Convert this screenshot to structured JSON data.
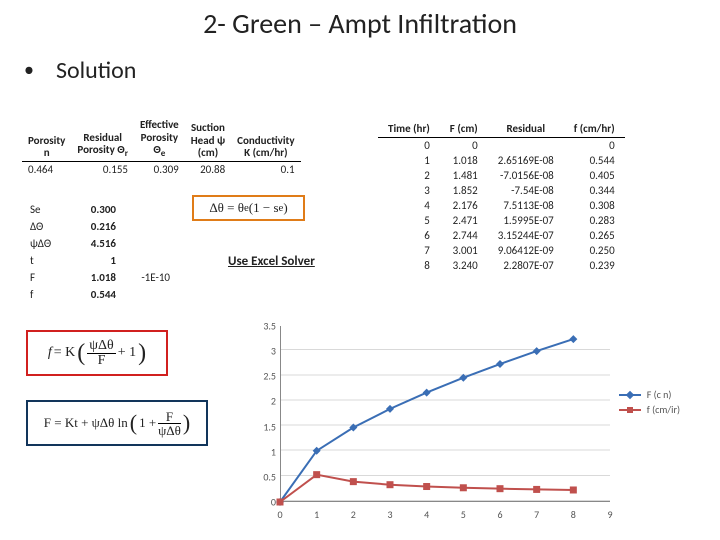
{
  "title": "2- Green – Ampt Infiltration",
  "bullet": "Solution",
  "params": {
    "headers": [
      "Porosity n",
      "Residual Porosity Θr",
      "Effective Porosity Θe",
      "Suction Head ψ (cm)",
      "Conductivity K (cm/hr)"
    ],
    "row": [
      "0.464",
      "0.155",
      "0.309",
      "20.88",
      "0.1"
    ]
  },
  "vals_left": [
    [
      "Se",
      "0.300",
      ""
    ],
    [
      "ΔΘ",
      "0.216",
      ""
    ],
    [
      "ψΔΘ",
      "4.516",
      ""
    ],
    [
      "t",
      "1",
      ""
    ],
    [
      "F",
      "1.018",
      "-1E-10"
    ],
    [
      "f",
      "0.544",
      ""
    ]
  ],
  "hl_orange": "Δθ = θe(1 − se)",
  "hl_red": "f = K ( ψΔθ / F + 1 )",
  "hl_navy": "F = Kt + ψΔθ ln( 1 + F / (ψΔθ) )",
  "solver_note": "Use Excel Solver",
  "data_table": {
    "headers": [
      "Time (hr)",
      "F (cm)",
      "Residual",
      "f (cm/hr)"
    ],
    "rows": [
      [
        "0",
        "0",
        "",
        "0"
      ],
      [
        "1",
        "1.018",
        "2.65169E-08",
        "0.544"
      ],
      [
        "2",
        "1.481",
        "-7.0156E-08",
        "0.405"
      ],
      [
        "3",
        "1.852",
        "-7.54E-08",
        "0.344"
      ],
      [
        "4",
        "2.176",
        "7.5113E-08",
        "0.308"
      ],
      [
        "5",
        "2.471",
        "1.5995E-07",
        "0.283"
      ],
      [
        "6",
        "2.744",
        "3.15244E-07",
        "0.265"
      ],
      [
        "7",
        "3.001",
        "9.06412E-09",
        "0.250"
      ],
      [
        "8",
        "3.240",
        "2.2807E-07",
        "0.239"
      ]
    ]
  },
  "chart_data": {
    "type": "line",
    "xlabel": "",
    "ylabel": "",
    "xlim": [
      0,
      9
    ],
    "ylim": [
      0,
      3.5
    ],
    "xticks": [
      0,
      1,
      2,
      3,
      4,
      5,
      6,
      7,
      8,
      9
    ],
    "yticks": [
      0,
      0.5,
      1,
      1.5,
      2,
      2.5,
      3,
      3.5
    ],
    "series": [
      {
        "name": "F (cm)",
        "color": "#3a6eb5",
        "marker": "diamond",
        "x": [
          0,
          1,
          2,
          3,
          4,
          5,
          6,
          7,
          8
        ],
        "y": [
          0,
          1.018,
          1.481,
          1.852,
          2.176,
          2.471,
          2.744,
          3.001,
          3.24
        ]
      },
      {
        "name": "f (cm/hr)",
        "color": "#c0504d",
        "marker": "square",
        "x": [
          0,
          1,
          2,
          3,
          4,
          5,
          6,
          7,
          8
        ],
        "y": [
          0,
          0.544,
          0.405,
          0.344,
          0.308,
          0.283,
          0.265,
          0.25,
          0.239
        ]
      }
    ],
    "legend": [
      "F (cm)",
      "f (cm/hr)"
    ],
    "legend_labels_as_rendered": [
      "F (c n)",
      "f (cm/ir)"
    ]
  }
}
